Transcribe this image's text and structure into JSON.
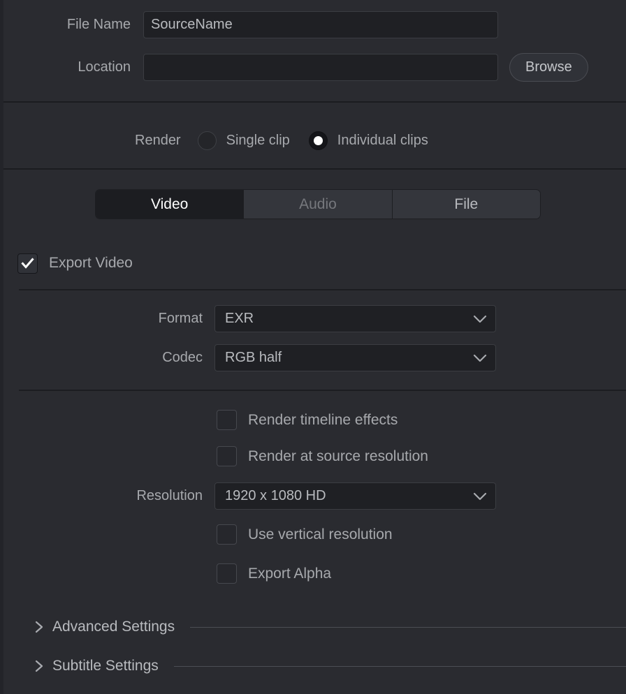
{
  "output": {
    "file_name_label": "File Name",
    "file_name_value": "SourceName",
    "location_label": "Location",
    "location_value": "",
    "location_placeholder": "",
    "browse_label": "Browse"
  },
  "render_mode": {
    "label": "Render",
    "options": [
      {
        "label": "Single clip",
        "selected": false
      },
      {
        "label": "Individual clips",
        "selected": true
      }
    ]
  },
  "tabs": [
    {
      "label": "Video",
      "active": true,
      "disabled": false
    },
    {
      "label": "Audio",
      "active": false,
      "disabled": true
    },
    {
      "label": "File",
      "active": false,
      "disabled": false
    }
  ],
  "export_video": {
    "label": "Export Video",
    "checked": true
  },
  "video_settings": {
    "format_label": "Format",
    "format_value": "EXR",
    "codec_label": "Codec",
    "codec_value": "RGB half",
    "render_timeline_effects_label": "Render timeline effects",
    "render_timeline_effects_checked": false,
    "render_at_source_resolution_label": "Render at source resolution",
    "render_at_source_resolution_checked": false,
    "resolution_label": "Resolution",
    "resolution_value": "1920 x 1080 HD",
    "use_vertical_resolution_label": "Use vertical resolution",
    "use_vertical_resolution_checked": false,
    "export_alpha_label": "Export Alpha",
    "export_alpha_checked": false
  },
  "collapsible_sections": [
    {
      "label": "Advanced Settings",
      "expanded": false
    },
    {
      "label": "Subtitle Settings",
      "expanded": false
    }
  ],
  "colors": {
    "panel_background": "#2a2b30",
    "input_background": "#1f2024",
    "accent_selected": "#ffffff",
    "text_primary": "#b9bbbf",
    "text_muted": "#76787d"
  }
}
